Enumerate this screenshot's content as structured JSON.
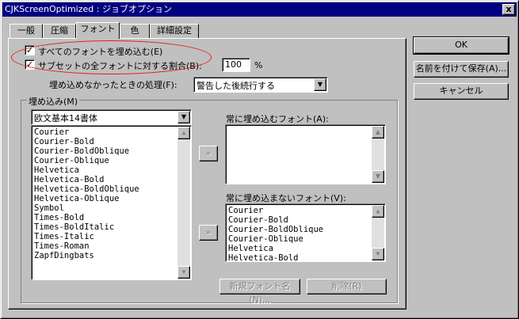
{
  "window": {
    "title": "CJKScreenOptimized : ジョブオプション",
    "close_glyph": "x"
  },
  "tabs": [
    {
      "label": "一般"
    },
    {
      "label": "圧縮"
    },
    {
      "label": "フォント"
    },
    {
      "label": "色"
    },
    {
      "label": "詳細設定"
    }
  ],
  "options": {
    "embed_all_label": "すべてのフォントを埋め込む(E)",
    "embed_all_checked": "✓",
    "subset_label": "サブセットの全フォントに対する割合(B):",
    "subset_checked": "✓",
    "subset_value": "100",
    "percent_sign": "%",
    "fail_label": "埋め込めなかったときの処理(F):",
    "fail_value": "警告した後続行する"
  },
  "embed": {
    "group_label": "埋め込み(M)",
    "source_value": "欧文基本14書体",
    "available_fonts": [
      "Courier",
      "Courier-Bold",
      "Courier-BoldOblique",
      "Courier-Oblique",
      "Helvetica",
      "Helvetica-Bold",
      "Helvetica-BoldOblique",
      "Helvetica-Oblique",
      "Symbol",
      "Times-Bold",
      "Times-BoldItalic",
      "Times-Italic",
      "Times-Roman",
      "ZapfDingbats"
    ],
    "always_embed_label": "常に埋め込むフォント(A):",
    "never_embed_label": "常に埋め込まないフォント(V):",
    "never_embed_fonts": [
      "Courier",
      "Courier-Bold",
      "Courier-BoldOblique",
      "Courier-Oblique",
      "Helvetica",
      "Helvetica-Bold"
    ],
    "move_glyph": "»",
    "new_font_label": "新規フォント名(N)...",
    "delete_label": "削除(R)"
  },
  "buttons": {
    "ok": "OK",
    "save_as": "名前を付けて保存(A)...",
    "cancel": "キャンセル"
  },
  "colors": {
    "title_bar": "#000080",
    "face": "#c0c0c0",
    "highlight_oval": "#e02020"
  }
}
